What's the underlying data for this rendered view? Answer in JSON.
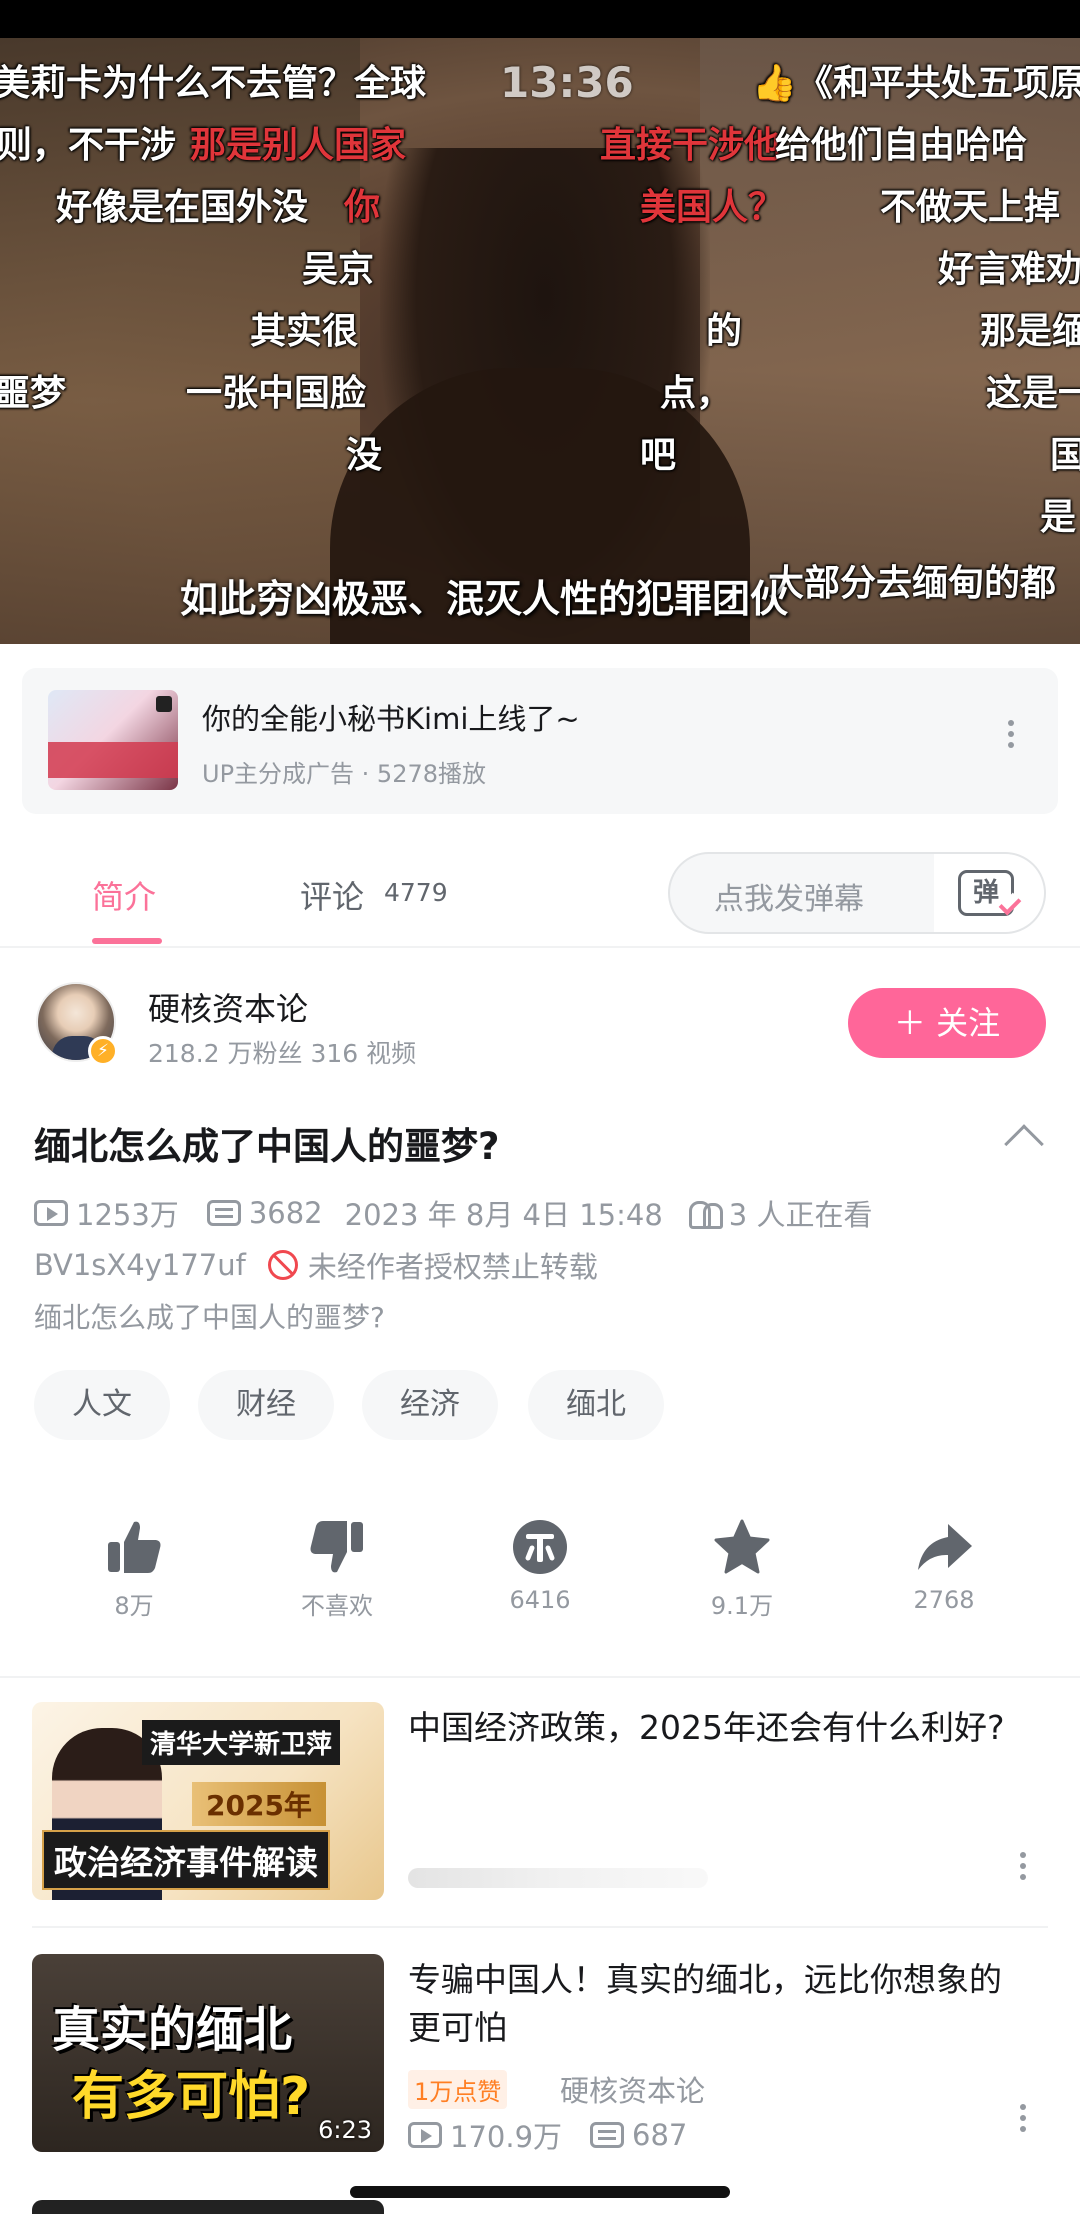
{
  "player": {
    "timer": "13:36",
    "progress_fraction": 0.05,
    "subtitle": "如此穷凶极恶、泯灭人性的犯罪团伙",
    "danmaku": [
      {
        "text": "美莉卡为什么不去管？全球",
        "red": false
      },
      {
        "text": "👍《和平共处五项原",
        "red": false
      },
      {
        "text": "则，不干涉",
        "red": false
      },
      {
        "text": "那是别人国家",
        "red": true
      },
      {
        "text": "直接干涉他",
        "red": true
      },
      {
        "text": "给他们自由哈哈",
        "red": false
      },
      {
        "text": "好像是在国外没",
        "red": false
      },
      {
        "text": "你",
        "red": true
      },
      {
        "text": "美国人？",
        "red": true
      },
      {
        "text": "不做天上掉",
        "red": false
      },
      {
        "text": "吴京",
        "red": false
      },
      {
        "text": "好言难劝",
        "red": false
      },
      {
        "text": "其实很",
        "red": false
      },
      {
        "text": "的",
        "red": false
      },
      {
        "text": "那是缅",
        "red": false
      },
      {
        "text": "噩梦",
        "red": false
      },
      {
        "text": "一张中国脸",
        "red": false
      },
      {
        "text": "点，",
        "red": false
      },
      {
        "text": "这是一",
        "red": false
      },
      {
        "text": "没",
        "red": false
      },
      {
        "text": "吧",
        "red": false
      },
      {
        "text": "国",
        "red": false
      },
      {
        "text": "是",
        "red": false
      },
      {
        "text": "大部分去缅甸的都",
        "red": false
      }
    ]
  },
  "ad": {
    "title": "你的全能小秘书Kimi上线了~",
    "meta": "UP主分成广告 · 5278播放"
  },
  "tabs": {
    "intro": "简介",
    "comment": "评论",
    "comment_count": "4779",
    "danmaku_placeholder": "点我发弹幕",
    "danmaku_btn": "弹"
  },
  "uploader": {
    "name": "硬核资本论",
    "stats": "218.2 万粉丝   316 视频",
    "follow": "＋ 关注"
  },
  "video": {
    "title": "缅北怎么成了中国人的噩梦?",
    "views": "1253万",
    "danmaku_count": "3682",
    "date": "2023 年 8月 4日 15:48",
    "watching": "3 人正在看",
    "bv": "BV1sX4y177uf",
    "copyright": "未经作者授权禁止转载",
    "desc": "缅北怎么成了中国人的噩梦?"
  },
  "tags": [
    "人文",
    "财经",
    "经济",
    "缅北"
  ],
  "actions": [
    {
      "name": "like",
      "label": "8万"
    },
    {
      "name": "dislike",
      "label": "不喜欢"
    },
    {
      "name": "coin",
      "label": "6416"
    },
    {
      "name": "favorite",
      "label": "9.1万"
    },
    {
      "name": "share",
      "label": "2768"
    }
  ],
  "recommendations": [
    {
      "title": "中国经济政策，2025年还会有什么利好?",
      "thumb_caption_1": "清华大学新卫萍",
      "thumb_caption_2": "2025年",
      "thumb_caption_3": "政治经济事件解读"
    },
    {
      "title": "专骗中国人！真实的缅北，远比你想象的更可怕",
      "thumb_caption_1": "真实的缅北",
      "thumb_caption_2": "有多可怕?",
      "duration": "6:23",
      "hot_badge": "1万点赞",
      "author": "硬核资本论",
      "views": "170.9万",
      "danmaku_count": "687"
    }
  ],
  "colors": {
    "accent": "#fb7299",
    "follow": "#ff6699",
    "muted": "#9499a0",
    "ban": "#f0484f"
  }
}
